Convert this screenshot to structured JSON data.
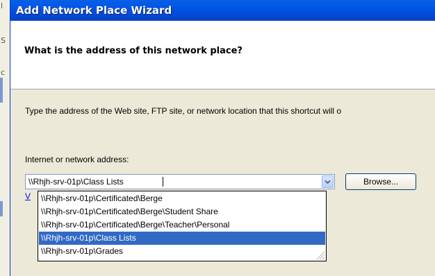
{
  "window": {
    "title": "Add Network Place Wizard"
  },
  "header": {
    "question": "What is the address of this network place?"
  },
  "body": {
    "instructions": "Type the address of the Web site, FTP site, or network location that this shortcut will o",
    "address_label": "Internet or network address:",
    "address_value": "\\\\Rhjh-srv-01p\\Class Lists",
    "browse_label": "Browse...",
    "partial_link_char": "V"
  },
  "dropdown": {
    "items": [
      "\\\\Rhjh-srv-01p\\Certificated\\Berge",
      "\\\\Rhjh-srv-01p\\Certificated\\Berge\\Student Share",
      "\\\\Rhjh-srv-01p\\Certificated\\Berge\\Teacher\\Personal",
      "\\\\Rhjh-srv-01p\\Class Lists",
      "\\\\Rhjh-srv-01p\\Grades"
    ],
    "selected_index": 3
  },
  "background": {
    "edge_glyphs": [
      "l",
      "S",
      "c"
    ]
  },
  "colors": {
    "titlebar": "#0054e3",
    "selection": "#316ac5",
    "dialog_face": "#ece9d8"
  },
  "icons": [
    "dropdown-arrow-icon",
    "resize-grip-icon"
  ]
}
